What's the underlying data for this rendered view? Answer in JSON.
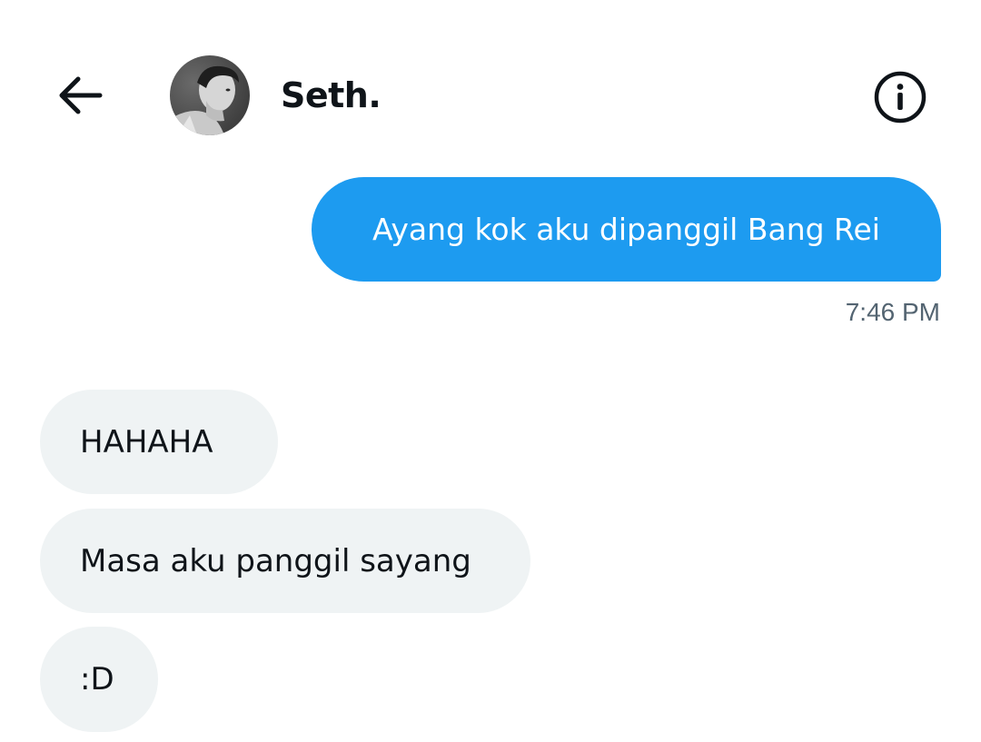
{
  "header": {
    "back_icon": "arrow-left-icon",
    "contact_name": "Seth.",
    "avatar": "contact-avatar",
    "info_icon": "info-icon"
  },
  "messages": [
    {
      "direction": "sent",
      "text": "Ayang kok aku dipanggil Bang Rei"
    },
    {
      "direction": "received",
      "text": "HAHAHA"
    },
    {
      "direction": "received",
      "text": "Masa aku panggil sayang"
    },
    {
      "direction": "received",
      "text": ":D"
    }
  ],
  "sent_timestamp": "7:46 PM",
  "colors": {
    "sent_bubble": "#1d9bf0",
    "received_bubble": "#eff3f4",
    "text_primary": "#0f1419",
    "text_secondary": "#536471"
  }
}
